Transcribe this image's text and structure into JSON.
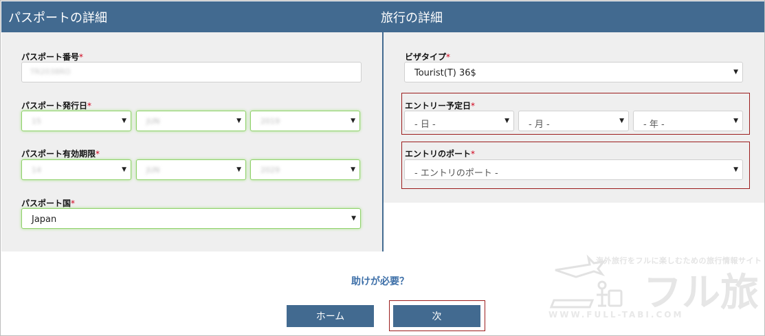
{
  "headers": {
    "passport": "パスポートの詳細",
    "travel": "旅行の詳細"
  },
  "passport": {
    "number_label": "パスポート番号",
    "number_value": "TR2038RO",
    "issue_label": "パスポート発行日",
    "issue_day": "15",
    "issue_month": "JUN",
    "issue_year": "2019",
    "expiry_label": "パスポート有効期限",
    "expiry_day": "14",
    "expiry_month": "JUN",
    "expiry_year": "2029",
    "country_label": "パスポート国",
    "country_value": "Japan"
  },
  "travel": {
    "visa_label": "ビザタイプ",
    "visa_value": "Tourist(T) 36$",
    "entry_date_label": "エントリー予定日",
    "day_placeholder": "- 日 -",
    "month_placeholder": "- 月 -",
    "year_placeholder": "- 年 -",
    "port_label": "エントリのポート",
    "port_placeholder": "- エントリのポート -"
  },
  "required_mark": "*",
  "help_link": "助けが必要？",
  "buttons": {
    "home": "ホーム",
    "next": "次"
  },
  "watermark": {
    "tagline": "海外旅行をフルに楽しむための旅行情報サイト",
    "title": "フル旅",
    "url": "WWW.FULL-TABI.COM"
  },
  "icons": {
    "dropdown": "chevron-down-icon"
  },
  "colors": {
    "header": "#426a90",
    "required": "#d0021b",
    "highlight_border": "#9b1b1b",
    "valid_border": "#8fd16a"
  }
}
